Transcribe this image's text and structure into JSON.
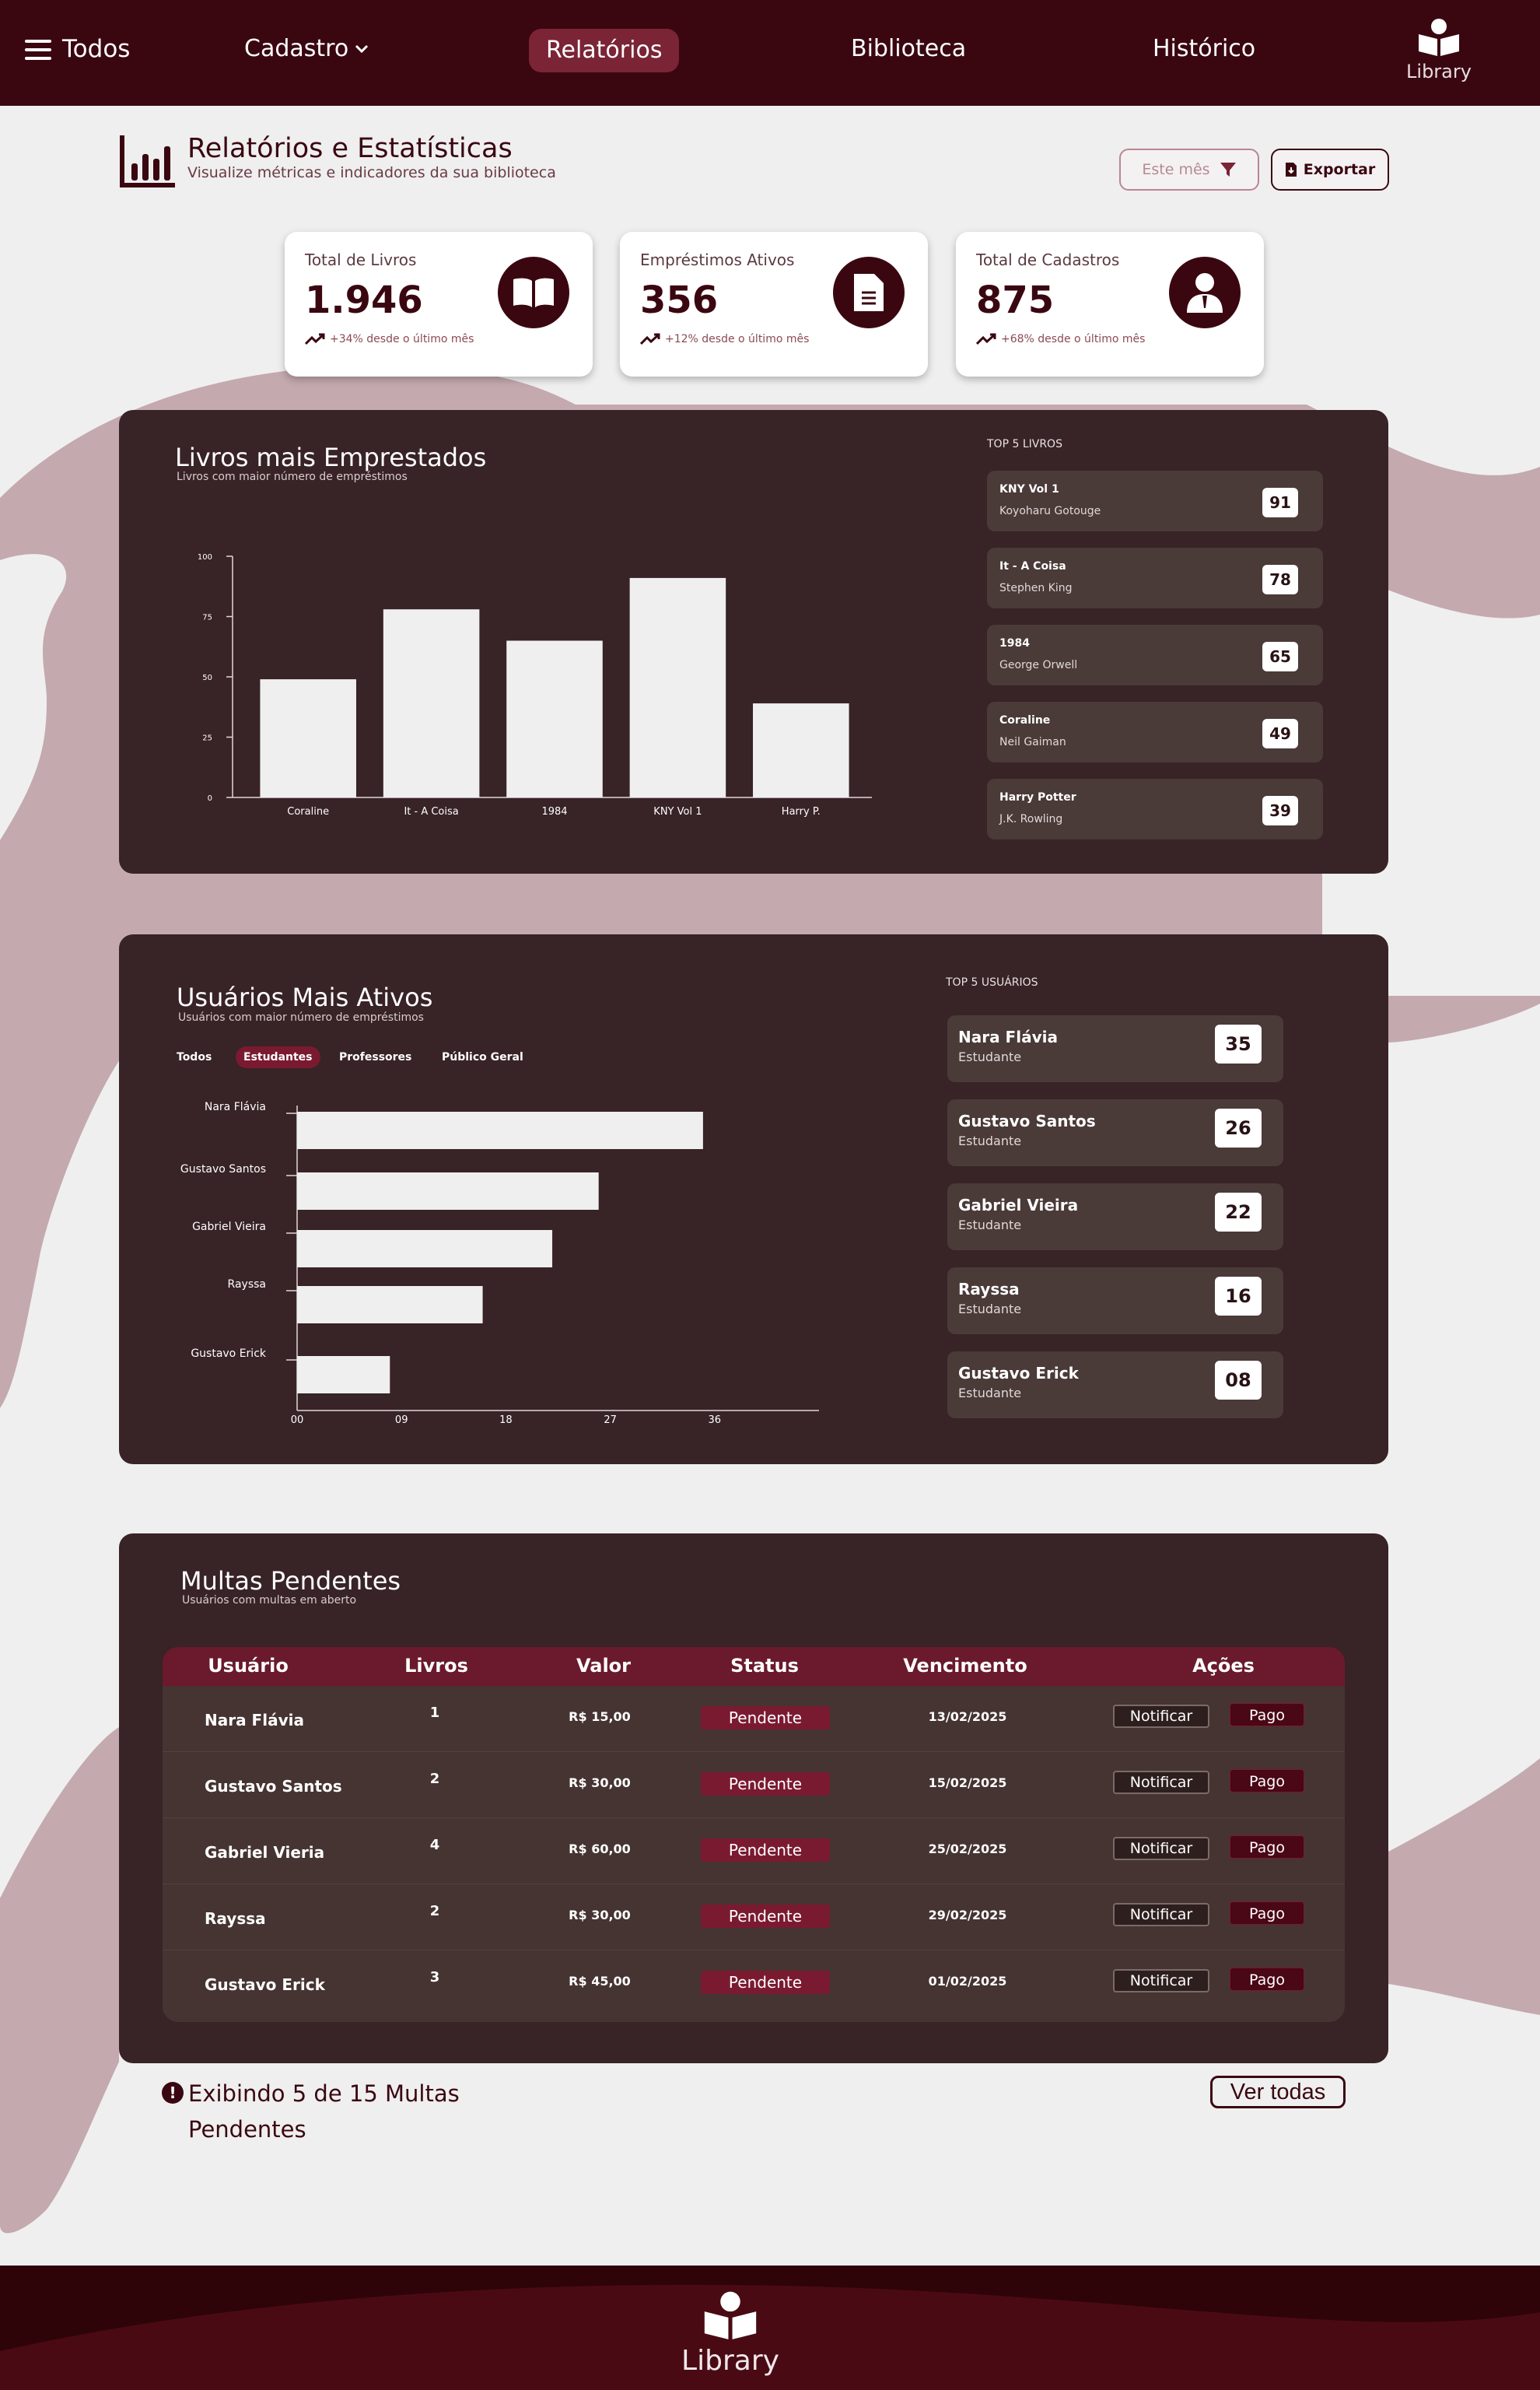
{
  "nav": {
    "all_label": "Todos",
    "cadastro_label": "Cadastro",
    "relatorios_label": "Relatórios",
    "biblioteca_label": "Biblioteca",
    "historico_label": "Histórico",
    "library_label": "Library"
  },
  "header": {
    "title": "Relatórios e Estatísticas",
    "subtitle": "Visualize métricas e indicadores da sua biblioteca",
    "filter_label": "Este mês",
    "export_label": "Exportar"
  },
  "stats": [
    {
      "label": "Total de Livros",
      "value": "1.946",
      "trend": "+34% desde o último mês",
      "icon": "book-open-icon"
    },
    {
      "label": "Empréstimos Ativos",
      "value": "356",
      "trend": "+12% desde o último mês",
      "icon": "document-icon"
    },
    {
      "label": "Total de Cadastros",
      "value": "875",
      "trend": "+68% desde o último mês",
      "icon": "user-icon"
    }
  ],
  "books_panel": {
    "title": "Livros mais Emprestados",
    "subtitle": "Livros com maior número de empréstimos",
    "top_heading": "TOP 5 LIVROS",
    "top": [
      {
        "title": "KNY Vol 1",
        "author": "Koyoharu Gotouge",
        "count": "91"
      },
      {
        "title": "It - A Coisa",
        "author": "Stephen King",
        "count": "78"
      },
      {
        "title": "1984",
        "author": "George Orwell",
        "count": "65"
      },
      {
        "title": "Coraline",
        "author": "Neil Gaiman",
        "count": "49"
      },
      {
        "title": "Harry Potter",
        "author": "J.K. Rowling",
        "count": "39"
      }
    ]
  },
  "users_panel": {
    "title": "Usuários Mais Ativos",
    "subtitle": "Usuários com maior número de empréstimos",
    "top_heading": "TOP 5 USUÁRIOS",
    "tabs": [
      "Todos",
      "Estudantes",
      "Professores",
      "Público Geral"
    ],
    "active_tab": "Estudantes",
    "top": [
      {
        "name": "Nara Flávia",
        "role": "Estudante",
        "count": "35"
      },
      {
        "name": "Gustavo Santos",
        "role": "Estudante",
        "count": "26"
      },
      {
        "name": "Gabriel Vieira",
        "role": "Estudante",
        "count": "22"
      },
      {
        "name": "Rayssa",
        "role": "Estudante",
        "count": "16"
      },
      {
        "name": "Gustavo Erick",
        "role": "Estudante",
        "count": "08"
      }
    ]
  },
  "fines_panel": {
    "title": "Multas Pendentes",
    "subtitle": "Usuários com multas em aberto",
    "columns": [
      "Usuário",
      "Livros",
      "Valor",
      "Status",
      "Vencimento",
      "Ações"
    ],
    "notify_label": "Notificar",
    "paid_label": "Pago",
    "rows": [
      {
        "user": "Nara Flávia",
        "books": "1",
        "value": "R$ 15,00",
        "status": "Pendente",
        "due": "13/02/2025"
      },
      {
        "user": "Gustavo Santos",
        "books": "2",
        "value": "R$ 30,00",
        "status": "Pendente",
        "due": "15/02/2025"
      },
      {
        "user": "Gabriel Vieria",
        "books": "4",
        "value": "R$ 60,00",
        "status": "Pendente",
        "due": "25/02/2025"
      },
      {
        "user": "Rayssa",
        "books": "2",
        "value": "R$ 30,00",
        "status": "Pendente",
        "due": "29/02/2025"
      },
      {
        "user": "Gustavo Erick",
        "books": "3",
        "value": "R$ 45,00",
        "status": "Pendente",
        "due": "01/02/2025"
      }
    ]
  },
  "footer_info": {
    "showing_text": "Exibindo 5 de 15 Multas Pendentes",
    "see_all_label": "Ver todas",
    "library_label": "Library"
  },
  "colors": {
    "brand": "#3a0711",
    "accent": "#7a2436",
    "panel": "#382326",
    "blob": "#c4a9af"
  },
  "chart_data": [
    {
      "type": "bar",
      "categories": [
        "Coraline",
        "It - A Coisa",
        "1984",
        "KNY Vol 1",
        "Harry P."
      ],
      "values": [
        49,
        78,
        65,
        91,
        39
      ],
      "yticks": [
        "0",
        "25",
        "50",
        "75",
        "100"
      ],
      "ylim": [
        0,
        100
      ],
      "grid": false
    },
    {
      "type": "bar",
      "orientation": "horizontal",
      "categories": [
        "Nara Flávia",
        "Gustavo Santos",
        "Gabriel Vieira",
        "Rayssa",
        "Gustavo Erick"
      ],
      "values": [
        35,
        26,
        22,
        16,
        8
      ],
      "xticks": [
        "00",
        "09",
        "18",
        "27",
        "36"
      ],
      "xlim": [
        0,
        45
      ],
      "grid": false
    }
  ]
}
